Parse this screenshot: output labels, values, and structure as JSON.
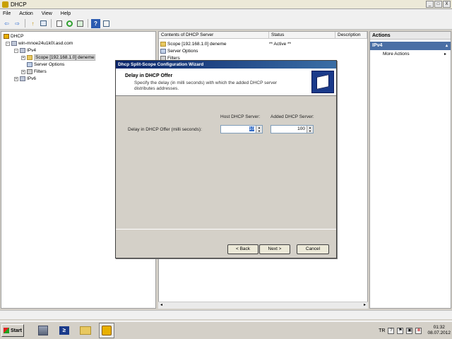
{
  "window": {
    "title": "DHCP",
    "min": "_",
    "max": "□",
    "close": "X"
  },
  "menu": [
    "File",
    "Action",
    "View",
    "Help"
  ],
  "toolbar": {
    "back": "⇦",
    "forward": "⇨",
    "up": "↑",
    "help": "?"
  },
  "tree": {
    "root": "DHCP",
    "server": "win-mnoe24u1k0l.asd.com",
    "ipv4": "IPv4",
    "scope": "Scope [192.168.1.0] deneme",
    "server_options": "Server Options",
    "filters": "Filters",
    "ipv6": "IPv6",
    "expand_minus": "−",
    "expand_plus": "+"
  },
  "list": {
    "columns": [
      "Contents of DHCP Server",
      "Status",
      "Description"
    ],
    "rows": [
      {
        "name": "Scope [192.168.1.0] deneme",
        "status": "** Active **"
      },
      {
        "name": "Server Options",
        "status": ""
      },
      {
        "name": "Filters",
        "status": ""
      }
    ],
    "scroll_left": "◂",
    "scroll_right": "▸"
  },
  "actions": {
    "header": "Actions",
    "section": "IPv4",
    "section_caret": "▴",
    "items": [
      {
        "label": "More Actions",
        "caret": "▸"
      }
    ]
  },
  "dialog": {
    "title": "Dhcp Split-Scope Configuration Wizard",
    "heading": "Delay in DHCP Offer",
    "description": "Specify the delay (in milli seconds) with which the added DHCP server distributes addresses.",
    "host_label": "Host DHCP Server:",
    "added_label": "Added DHCP Server:",
    "delay_label": "Delay in DHCP Offer (milli seconds):",
    "host_value": "10",
    "added_value": "100",
    "spin_up": "▲",
    "spin_down": "▼",
    "back_button": "< Back",
    "next_button": "Next >",
    "cancel_button": "Cancel"
  },
  "taskbar": {
    "start": "Start",
    "ps_glyph": "≥",
    "lang": "TR",
    "tray_help": "?",
    "tray_flag": "⚑",
    "tray_net": "▣",
    "tray_vol": "⊗",
    "time": "01:32",
    "date": "08.07.2012"
  }
}
